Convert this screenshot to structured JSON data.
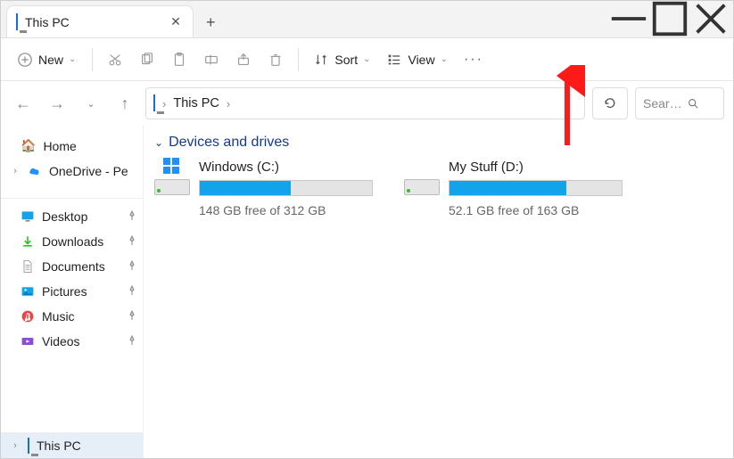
{
  "titlebar": {
    "tab_title": "This PC",
    "tab_close": "✕",
    "new_tab": "+"
  },
  "window_controls": {
    "min": "—",
    "max": "▢",
    "close": "✕"
  },
  "toolbar": {
    "new_label": "New",
    "sort_label": "Sort",
    "view_label": "View",
    "more": "•••"
  },
  "nav": {
    "back": "←",
    "forward": "→",
    "up": "↑",
    "breadcrumb_sep": "›",
    "breadcrumb": "This PC",
    "refresh": "⟳",
    "search_placeholder": "Sear…"
  },
  "sidebar": {
    "home": "Home",
    "onedrive": "OneDrive - Pe",
    "desktop": "Desktop",
    "downloads": "Downloads",
    "documents": "Documents",
    "pictures": "Pictures",
    "music": "Music",
    "videos": "Videos",
    "this_pc": "This PC"
  },
  "content": {
    "section": "Devices and drives",
    "drives": [
      {
        "name": "Windows (C:)",
        "free_text": "148 GB free of 312 GB",
        "used_percent": 53
      },
      {
        "name": "My Stuff (D:)",
        "free_text": "52.1 GB free of 163 GB",
        "used_percent": 68
      }
    ]
  }
}
